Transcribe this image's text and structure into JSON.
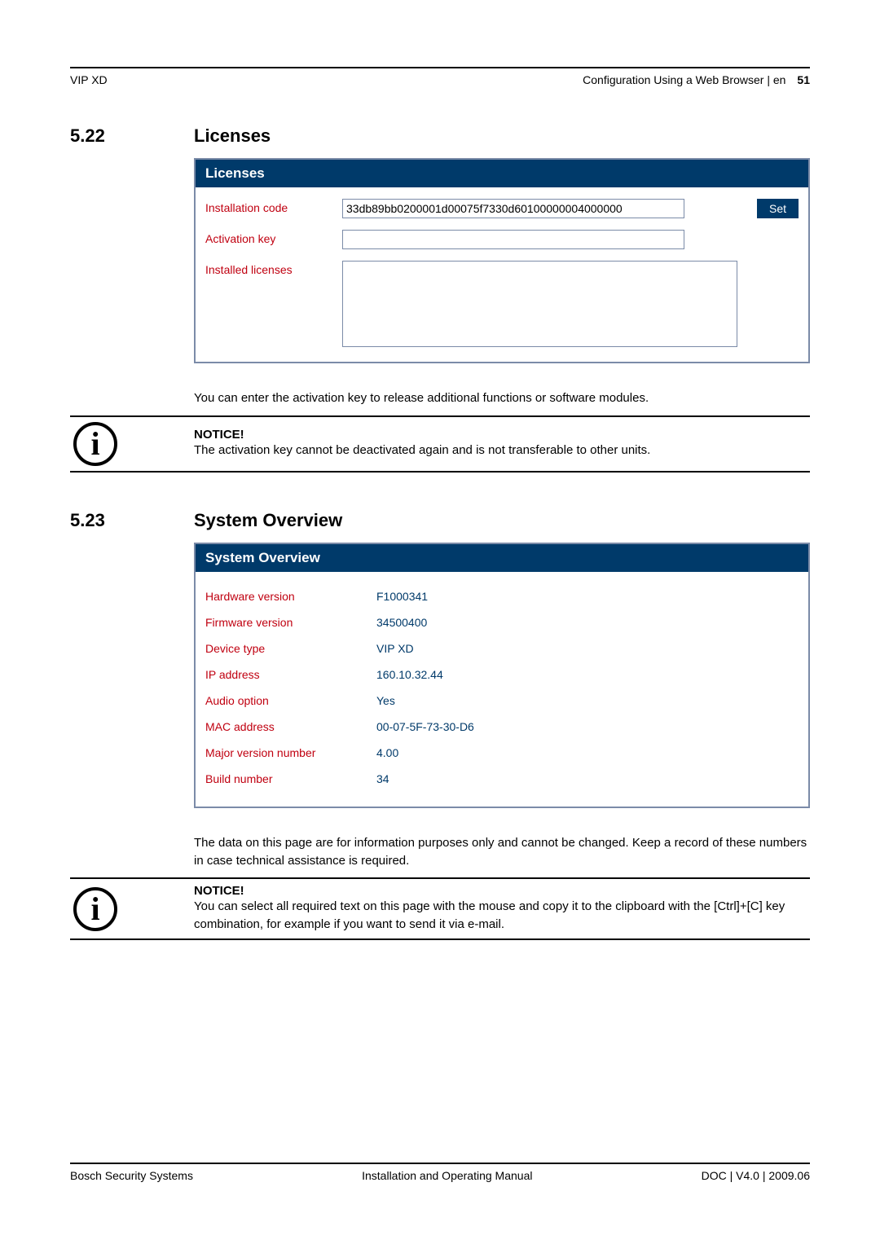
{
  "header": {
    "left": "VIP XD",
    "breadcrumb": "Configuration Using a Web Browser | en",
    "page_num": "51"
  },
  "sections": {
    "licenses": {
      "number": "5.22",
      "title": "Licenses",
      "panel_title": "Licenses",
      "rows": {
        "install_code_label": "Installation code",
        "install_code_value": "33db89bb0200001d00075f7330d60100000004000000",
        "set_button": "Set",
        "activation_key_label": "Activation key",
        "activation_key_value": "",
        "installed_licenses_label": "Installed licenses",
        "installed_licenses_value": ""
      },
      "description": "You can enter the activation key to release additional functions or software modules.",
      "notice_heading": "NOTICE!",
      "notice_body": "The activation key cannot be deactivated again and is not transferable to other units."
    },
    "overview": {
      "number": "5.23",
      "title": "System Overview",
      "panel_title": "System Overview",
      "rows": [
        {
          "label": "Hardware version",
          "value": "F1000341"
        },
        {
          "label": "Firmware version",
          "value": "34500400"
        },
        {
          "label": "Device type",
          "value": "VIP XD"
        },
        {
          "label": "IP address",
          "value": "160.10.32.44"
        },
        {
          "label": "Audio option",
          "value": "Yes"
        },
        {
          "label": "MAC address",
          "value": "00-07-5F-73-30-D6"
        },
        {
          "label": "Major version number",
          "value": "4.00"
        },
        {
          "label": "Build number",
          "value": "34"
        }
      ],
      "description": "The data on this page are for information purposes only and cannot be changed. Keep a record of these numbers in case technical assistance is required.",
      "notice_heading": "NOTICE!",
      "notice_body": "You can select all required text on this page with the mouse and copy it to the clipboard with the [Ctrl]+[C] key combination, for example if you want to send it via e-mail."
    }
  },
  "footer": {
    "left": "Bosch Security Systems",
    "center": "Installation and Operating Manual",
    "right": "DOC | V4.0 | 2009.06"
  },
  "icons": {
    "info_glyph": "i"
  }
}
